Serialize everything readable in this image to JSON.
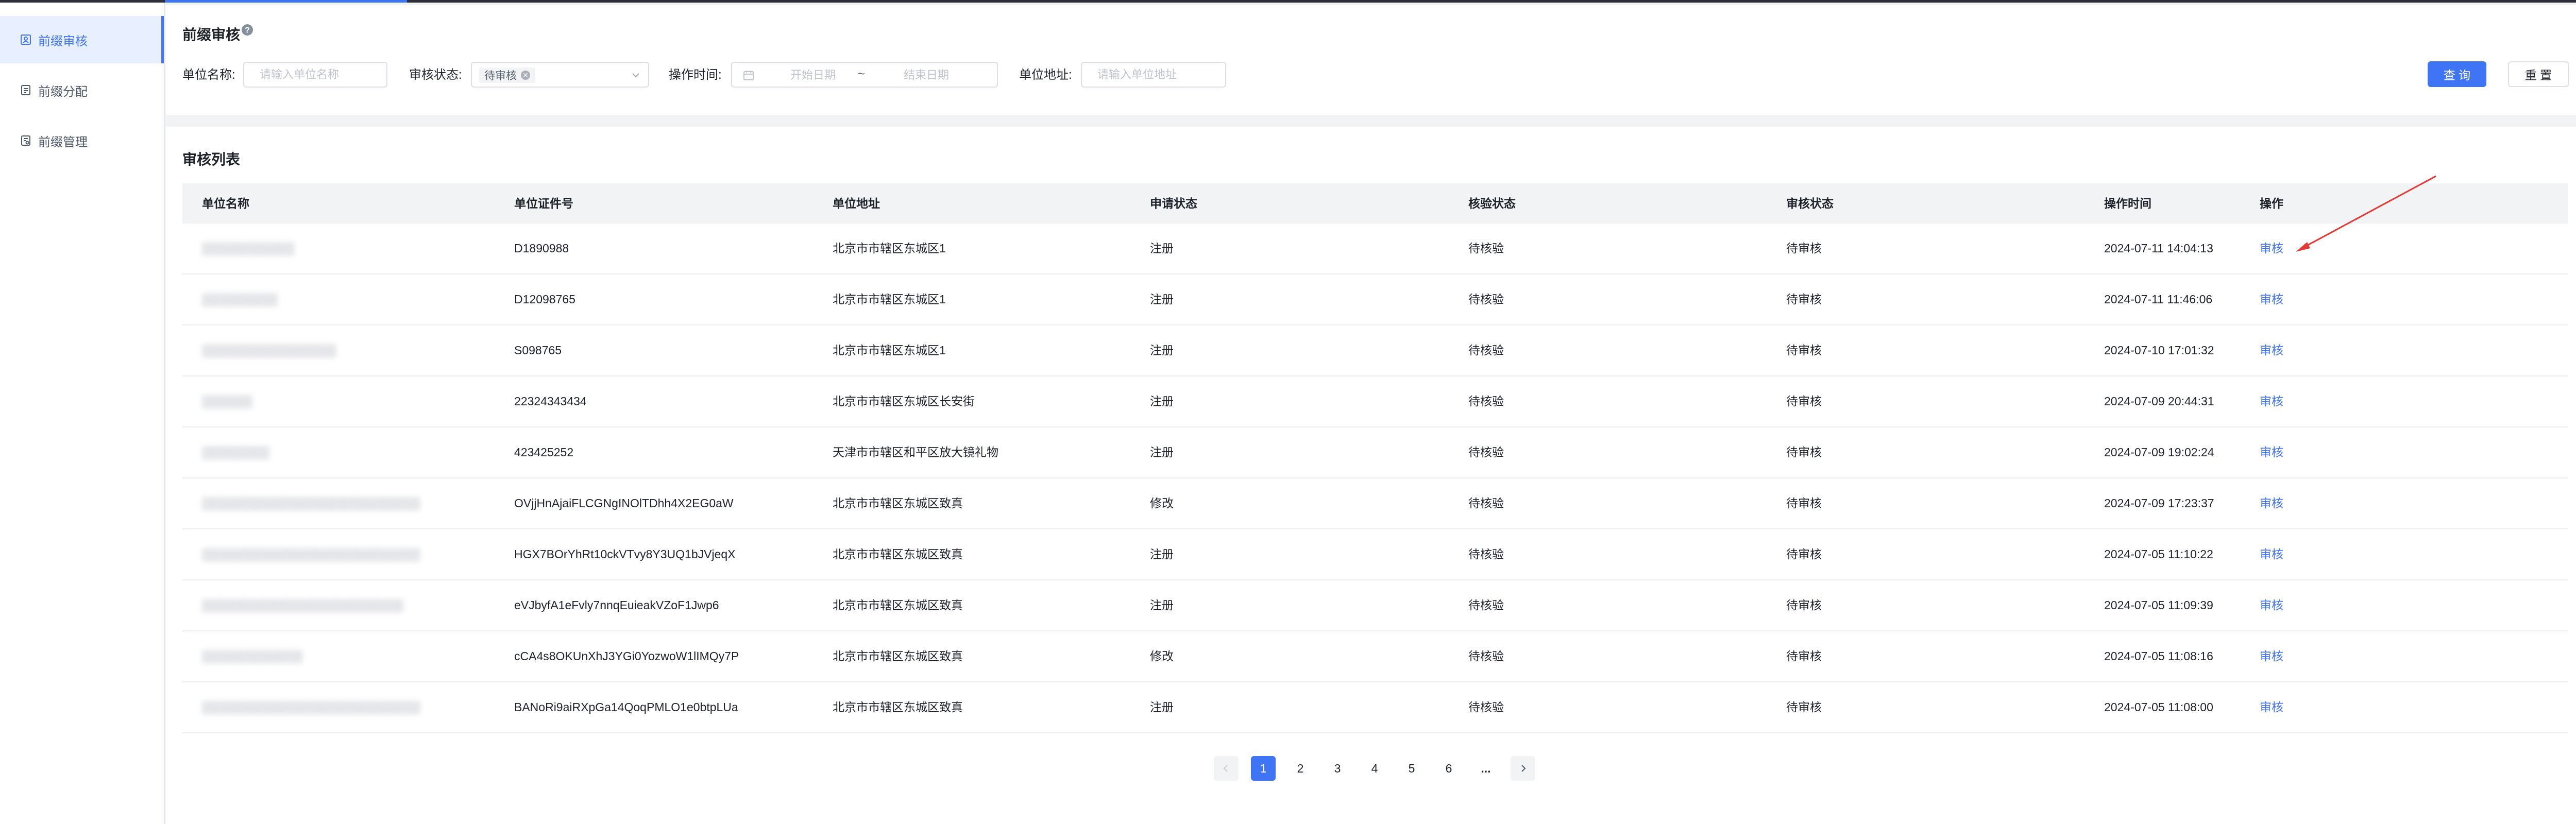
{
  "sidebar": {
    "items": [
      {
        "label": "前缀审核",
        "icon": "audit-icon",
        "active": true
      },
      {
        "label": "前缀分配",
        "icon": "allocate-icon",
        "active": false
      },
      {
        "label": "前缀管理",
        "icon": "manage-icon",
        "active": false
      }
    ]
  },
  "header": {
    "title": "前缀审核",
    "help_icon": "question-circle-icon"
  },
  "filters": {
    "unit_name_label": "单位名称:",
    "unit_name_placeholder": "请输入单位名称",
    "status_label": "审核状态:",
    "status_tag": "待审核",
    "operate_time_label": "操作时间:",
    "start_date_placeholder": "开始日期",
    "date_separator": "~",
    "end_date_placeholder": "结束日期",
    "address_label": "单位地址:",
    "address_placeholder": "请输入单位地址",
    "query_button": "查 询",
    "reset_button": "重 置"
  },
  "list": {
    "title": "审核列表",
    "columns": [
      "单位名称",
      "单位证件号",
      "单位地址",
      "申请状态",
      "核验状态",
      "审核状态",
      "操作时间",
      "操作"
    ],
    "rows": [
      {
        "name": "▒▒▒▒▒▒▒▒▒▒▒",
        "cert": "D1890988",
        "address": "北京市市辖区东城区1",
        "apply": "注册",
        "verify": "待核验",
        "audit": "待审核",
        "time": "2024-07-11 14:04:13",
        "op": "审核"
      },
      {
        "name": "▒▒▒▒▒▒▒▒▒",
        "cert": "D12098765",
        "address": "北京市市辖区东城区1",
        "apply": "注册",
        "verify": "待核验",
        "audit": "待审核",
        "time": "2024-07-11 11:46:06",
        "op": "审核"
      },
      {
        "name": "▒▒▒▒▒▒▒▒▒▒▒▒▒▒▒▒",
        "cert": "S098765",
        "address": "北京市市辖区东城区1",
        "apply": "注册",
        "verify": "待核验",
        "audit": "待审核",
        "time": "2024-07-10 17:01:32",
        "op": "审核"
      },
      {
        "name": "▒▒▒▒▒▒",
        "cert": "22324343434",
        "address": "北京市市辖区东城区长安街",
        "apply": "注册",
        "verify": "待核验",
        "audit": "待审核",
        "time": "2024-07-09 20:44:31",
        "op": "审核"
      },
      {
        "name": "▒▒▒▒▒▒▒▒",
        "cert": "423425252",
        "address": "天津市市辖区和平区放大镜礼物",
        "apply": "注册",
        "verify": "待核验",
        "audit": "待审核",
        "time": "2024-07-09 19:02:24",
        "op": "审核"
      },
      {
        "name": "▒▒▒▒▒▒▒▒▒▒▒▒▒▒▒▒▒▒▒▒▒▒▒▒▒▒",
        "cert": "OVjjHnAjaiFLCGNgINOlTDhh4X2EG0aW",
        "address": "北京市市辖区东城区致真",
        "apply": "修改",
        "verify": "待核验",
        "audit": "待审核",
        "time": "2024-07-09 17:23:37",
        "op": "审核"
      },
      {
        "name": "▒▒▒▒▒▒▒▒▒▒▒▒▒▒▒▒▒▒▒▒▒▒▒▒▒▒",
        "cert": "HGX7BOrYhRt10ckVTvy8Y3UQ1bJVjeqX",
        "address": "北京市市辖区东城区致真",
        "apply": "注册",
        "verify": "待核验",
        "audit": "待审核",
        "time": "2024-07-05 11:10:22",
        "op": "审核"
      },
      {
        "name": "▒▒▒▒▒▒▒▒▒▒▒▒▒▒▒▒▒▒▒▒▒▒▒▒",
        "cert": "eVJbyfA1eFvly7nnqEuieakVZoF1Jwp6",
        "address": "北京市市辖区东城区致真",
        "apply": "注册",
        "verify": "待核验",
        "audit": "待审核",
        "time": "2024-07-05 11:09:39",
        "op": "审核"
      },
      {
        "name": "▒▒▒▒▒▒▒▒▒▒▒▒",
        "cert": "cCA4s8OKUnXhJ3YGi0YozwoW1lIMQy7P",
        "address": "北京市市辖区东城区致真",
        "apply": "修改",
        "verify": "待核验",
        "audit": "待审核",
        "time": "2024-07-05 11:08:16",
        "op": "审核"
      },
      {
        "name": "▒▒▒▒▒▒▒▒▒▒▒▒▒▒▒▒▒▒▒▒▒▒▒▒▒▒",
        "cert": "BANoRi9aiRXpGa14QoqPMLO1e0btpLUa",
        "address": "北京市市辖区东城区致真",
        "apply": "注册",
        "verify": "待核验",
        "audit": "待审核",
        "time": "2024-07-05 11:08:00",
        "op": "审核"
      }
    ]
  },
  "pagination": {
    "prev_icon": "chevron-left-icon",
    "pages": [
      "1",
      "2",
      "3",
      "4",
      "5",
      "6"
    ],
    "current": "1",
    "ellipsis": "...",
    "next_icon": "chevron-right-icon"
  },
  "colors": {
    "primary": "#3f74f4",
    "annotation_arrow": "#e53935"
  }
}
